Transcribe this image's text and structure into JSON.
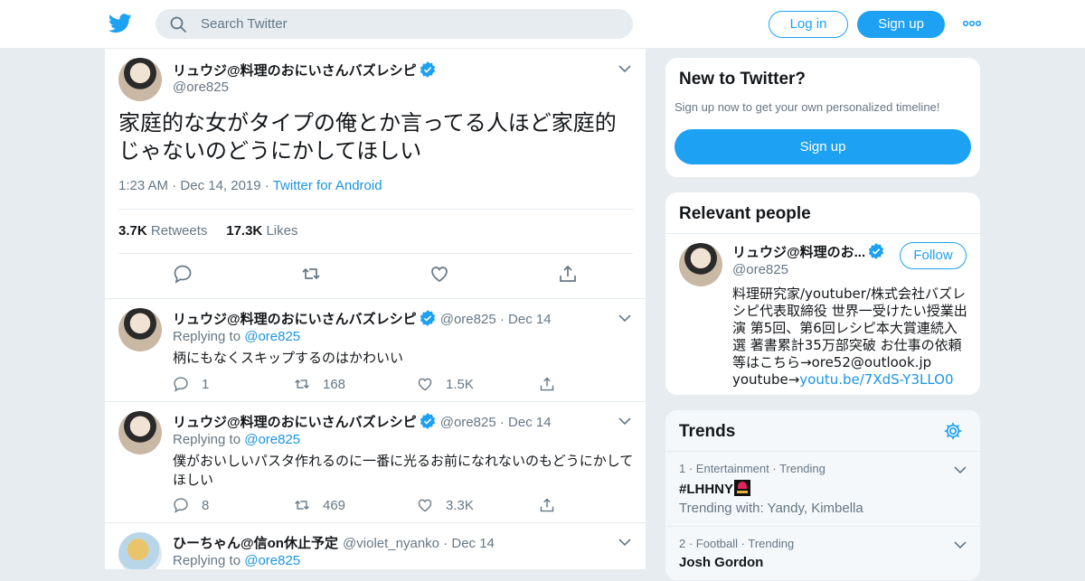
{
  "header": {
    "search_placeholder": "Search Twitter",
    "login_label": "Log in",
    "signup_label": "Sign up"
  },
  "main_tweet": {
    "name": "リュウジ@料理のおにいさんバズレシピ",
    "handle": "@ore825",
    "text": "家庭的な女がタイプの俺とか言ってる人ほど家庭的じゃないのどうにかしてほしい",
    "time": "1:23 AM",
    "date": "Dec 14, 2019",
    "source": "Twitter for Android",
    "retweets_count": "3.7K",
    "retweets_label": "Retweets",
    "likes_count": "17.3K",
    "likes_label": "Likes"
  },
  "replies": [
    {
      "name": "リュウジ@料理のおにいさんバズレシピ",
      "handle": "@ore825",
      "date": "Dec 14",
      "replying_prefix": "Replying to",
      "replying_to": "@ore825",
      "text": "柄にもなくスキップするのはかわいい",
      "replies": "1",
      "retweets": "168",
      "likes": "1.5K"
    },
    {
      "name": "リュウジ@料理のおにいさんバズレシピ",
      "handle": "@ore825",
      "date": "Dec 14",
      "replying_prefix": "Replying to",
      "replying_to": "@ore825",
      "text": "僕がおいしいパスタ作れるのに一番に光るお前になれないのもどうにかしてほしい",
      "replies": "8",
      "retweets": "469",
      "likes": "3.3K"
    },
    {
      "name": "ひーちゃん@信on休止予定",
      "handle": "@violet_nyanko",
      "date": "Dec 14",
      "replying_prefix": "Replying to",
      "replying_to": "@ore825"
    }
  ],
  "new_to_twitter": {
    "title": "New to Twitter?",
    "subtitle": "Sign up now to get your own personalized timeline!",
    "button": "Sign up"
  },
  "relevant_people": {
    "title": "Relevant people",
    "name": "リュウジ@料理のお...",
    "handle": "@ore825",
    "follow_label": "Follow",
    "bio": "料理研究家/youtuber/株式会社バズレシピ代表取締役 世界一受けたい授業出演 第5回、第6回レシピ本大賞連続入選 著書累計35万部突破 お仕事の依頼等はこちら→ore52@outlook.jp youtube→",
    "bio_link": "youtu.be/7XdS-Y3LLO0"
  },
  "trends": {
    "title": "Trends",
    "items": [
      {
        "rank": "1",
        "category": "Entertainment",
        "status": "Trending",
        "name": "#LHHNY",
        "sub": "Trending with: Yandy, Kimbella"
      },
      {
        "rank": "2",
        "category": "Football",
        "status": "Trending",
        "name": "Josh Gordon"
      }
    ]
  },
  "colors": {
    "accent": "#1da1f2",
    "link": "#1b95e0",
    "text_secondary": "#657786",
    "background": "#e6ecf0"
  },
  "icons": [
    "twitter-bird-icon",
    "search-icon",
    "more-icon",
    "verified-icon",
    "chevron-down-icon",
    "reply-icon",
    "retweet-icon",
    "like-icon",
    "share-icon",
    "gear-icon"
  ]
}
